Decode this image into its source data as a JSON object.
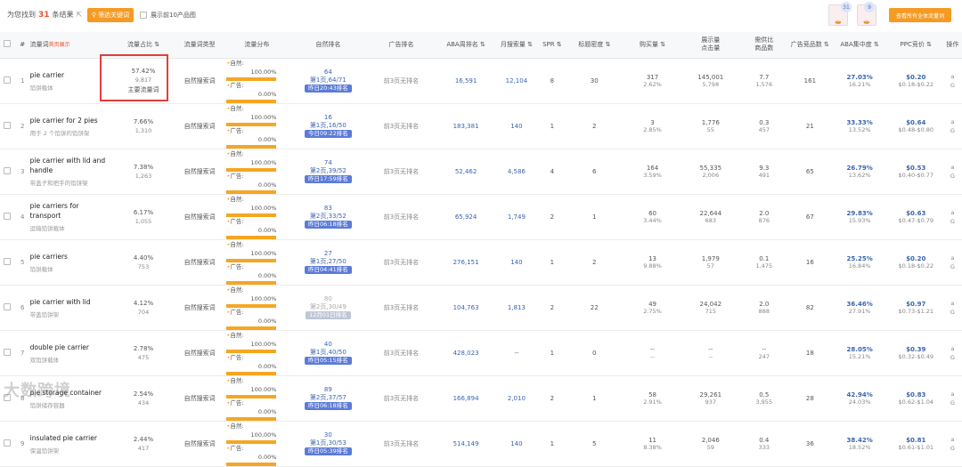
{
  "top": {
    "found_prefix": "为您找到",
    "found_count": "31",
    "found_suffix": "条结果",
    "filter_button": "筛选关键词",
    "show_top10": "展示前10产品图",
    "product_badges": [
      "31",
      "9"
    ],
    "view_all_button": "查看所有全体流量词"
  },
  "headers": [
    "#",
    "流量词",
    "流量占比",
    "流量词类型",
    "流量分布",
    "自然排名",
    "广告排名",
    "ABA周排名",
    "月搜索量",
    "SPR",
    "标题密度",
    "购买量",
    "展示量\n点击量",
    "需供比\n商品数",
    "广告竞品数",
    "ABA集中度",
    "PPC竞价",
    "操作"
  ],
  "header_sub": "首页展示",
  "dist_labels": {
    "natural": "自然:",
    "ad": "广告:"
  },
  "main_flag": "主要流量词",
  "rows": [
    {
      "idx": "1",
      "kw": "pie carrier",
      "cn": "馅饼载体",
      "share": "57.42%",
      "share_sub": "9,817",
      "flag": true,
      "type": "自然搜索词",
      "nat": "100.00%",
      "ad": "0.00%",
      "rank_num": "64",
      "rank_page": "第1页,64/71",
      "rank_tag": "昨日20:43排名",
      "tag_gray": false,
      "ad_rank": "前3页无排名",
      "aba": "16,591",
      "monthly": "12,104",
      "spr": "8",
      "title": "30",
      "buy": "317",
      "buy_sub": "2.62%",
      "imp": "145,001",
      "clk": "5,798",
      "ratio": "7.7",
      "goods": "1,576",
      "ad_comp": "161",
      "aba_c": "27.03%",
      "aba_c_sub": "16.21%",
      "ppc": "$0.20",
      "ppc_range": "$0.18-$0.22"
    },
    {
      "idx": "2",
      "kw": "pie carrier for 2 pies",
      "cn": "用于 2 个馅饼的馅饼架",
      "share": "7.66%",
      "share_sub": "1,310",
      "flag": false,
      "type": "自然搜索词",
      "nat": "100.00%",
      "ad": "0.00%",
      "rank_num": "16",
      "rank_page": "第1页,16/50",
      "rank_tag": "今日09:22排名",
      "tag_gray": false,
      "ad_rank": "前3页无排名",
      "aba": "183,381",
      "monthly": "140",
      "spr": "1",
      "title": "2",
      "buy": "3",
      "buy_sub": "2.85%",
      "imp": "1,776",
      "clk": "55",
      "ratio": "0.3",
      "goods": "457",
      "ad_comp": "21",
      "aba_c": "33.33%",
      "aba_c_sub": "13.52%",
      "ppc": "$0.64",
      "ppc_range": "$0.48-$0.80"
    },
    {
      "idx": "3",
      "kw": "pie carrier with lid and handle",
      "cn": "带盖子和把手的馅饼架",
      "share": "7.38%",
      "share_sub": "1,263",
      "flag": false,
      "type": "自然搜索词",
      "nat": "100.00%",
      "ad": "0.00%",
      "rank_num": "74",
      "rank_page": "第2页,39/52",
      "rank_tag": "昨日17:59排名",
      "tag_gray": false,
      "ad_rank": "前3页无排名",
      "aba": "52,462",
      "monthly": "4,586",
      "spr": "4",
      "title": "6",
      "buy": "164",
      "buy_sub": "3.59%",
      "imp": "55,335",
      "clk": "2,006",
      "ratio": "9.3",
      "goods": "491",
      "ad_comp": "65",
      "aba_c": "26.79%",
      "aba_c_sub": "13.62%",
      "ppc": "$0.53",
      "ppc_range": "$0.40-$0.77"
    },
    {
      "idx": "4",
      "kw": "pie carriers for transport",
      "cn": "运输馅饼载体",
      "share": "6.17%",
      "share_sub": "1,055",
      "flag": false,
      "type": "自然搜索词",
      "nat": "100.00%",
      "ad": "0.00%",
      "rank_num": "83",
      "rank_page": "第2页,33/52",
      "rank_tag": "昨日06:18排名",
      "tag_gray": false,
      "ad_rank": "前3页无排名",
      "aba": "65,924",
      "monthly": "1,749",
      "spr": "2",
      "title": "1",
      "buy": "60",
      "buy_sub": "3.44%",
      "imp": "22,644",
      "clk": "683",
      "ratio": "2.0",
      "goods": "876",
      "ad_comp": "67",
      "aba_c": "29.83%",
      "aba_c_sub": "15.93%",
      "ppc": "$0.63",
      "ppc_range": "$0.47-$0.79"
    },
    {
      "idx": "5",
      "kw": "pie carriers",
      "cn": "馅饼载体",
      "share": "4.40%",
      "share_sub": "753",
      "flag": false,
      "type": "自然搜索词",
      "nat": "100.00%",
      "ad": "0.00%",
      "rank_num": "27",
      "rank_page": "第1页,27/50",
      "rank_tag": "昨日04:41排名",
      "tag_gray": false,
      "ad_rank": "前3页无排名",
      "aba": "276,151",
      "monthly": "140",
      "spr": "1",
      "title": "2",
      "buy": "13",
      "buy_sub": "9.88%",
      "imp": "1,979",
      "clk": "57",
      "ratio": "0.1",
      "goods": "1,475",
      "ad_comp": "16",
      "aba_c": "25.25%",
      "aba_c_sub": "16.84%",
      "ppc": "$0.20",
      "ppc_range": "$0.18-$0.22"
    },
    {
      "idx": "6",
      "kw": "pie carrier with lid",
      "cn": "带盖馅饼架",
      "share": "4.12%",
      "share_sub": "704",
      "flag": false,
      "type": "自然搜索词",
      "nat": "100.00%",
      "ad": "0.00%",
      "rank_num": "80",
      "rank_page": "第2页,30/49",
      "rank_tag": "12月01日排名",
      "tag_gray": true,
      "ad_rank": "前3页无排名",
      "aba": "104,763",
      "monthly": "1,813",
      "spr": "2",
      "title": "22",
      "buy": "49",
      "buy_sub": "2.75%",
      "imp": "24,042",
      "clk": "715",
      "ratio": "2.0",
      "goods": "888",
      "ad_comp": "82",
      "aba_c": "36.46%",
      "aba_c_sub": "27.91%",
      "ppc": "$0.97",
      "ppc_range": "$0.73-$1.21"
    },
    {
      "idx": "7",
      "kw": "double pie carrier",
      "cn": "双馅饼载体",
      "share": "2.78%",
      "share_sub": "475",
      "flag": false,
      "type": "自然搜索词",
      "nat": "100.00%",
      "ad": "0.00%",
      "rank_num": "40",
      "rank_page": "第1页,40/50",
      "rank_tag": "昨日05:15排名",
      "tag_gray": false,
      "ad_rank": "前3页无排名",
      "aba": "428,023",
      "monthly": "--",
      "spr": "1",
      "title": "0",
      "buy": "--",
      "buy_sub": "--",
      "imp": "--",
      "clk": "--",
      "ratio": "--",
      "goods": "247",
      "ad_comp": "18",
      "aba_c": "28.05%",
      "aba_c_sub": "15.21%",
      "ppc": "$0.39",
      "ppc_range": "$0.32-$0.49"
    },
    {
      "idx": "8",
      "kw": "pie storage container",
      "cn": "馅饼储存容器",
      "share": "2.54%",
      "share_sub": "434",
      "flag": false,
      "type": "自然搜索词",
      "nat": "100.00%",
      "ad": "0.00%",
      "rank_num": "89",
      "rank_page": "第2页,37/57",
      "rank_tag": "昨日06:18排名",
      "tag_gray": false,
      "ad_rank": "前3页无排名",
      "aba": "166,894",
      "monthly": "2,010",
      "spr": "2",
      "title": "1",
      "buy": "58",
      "buy_sub": "2.91%",
      "imp": "29,261",
      "clk": "937",
      "ratio": "0.5",
      "goods": "3,955",
      "ad_comp": "28",
      "aba_c": "42.94%",
      "aba_c_sub": "24.03%",
      "ppc": "$0.83",
      "ppc_range": "$0.62-$1.04"
    },
    {
      "idx": "9",
      "kw": "insulated pie carrier",
      "cn": "保温馅饼架",
      "share": "2.44%",
      "share_sub": "417",
      "flag": false,
      "type": "自然搜索词",
      "nat": "100.00%",
      "ad": "0.00%",
      "rank_num": "30",
      "rank_page": "第1页,30/53",
      "rank_tag": "昨日05:39排名",
      "tag_gray": false,
      "ad_rank": "前3页无排名",
      "aba": "514,149",
      "monthly": "140",
      "spr": "1",
      "title": "5",
      "buy": "11",
      "buy_sub": "8.38%",
      "imp": "2,046",
      "clk": "59",
      "ratio": "0.4",
      "goods": "333",
      "ad_comp": "36",
      "aba_c": "38.42%",
      "aba_c_sub": "18.52%",
      "ppc": "$0.81",
      "ppc_range": "$0.61-$1.01"
    }
  ],
  "ops": [
    "a",
    "G"
  ],
  "watermark": "大数跨境"
}
